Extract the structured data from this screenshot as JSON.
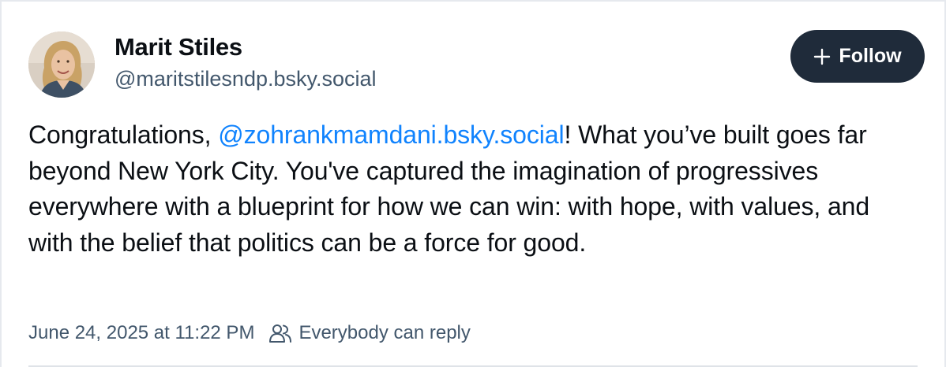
{
  "author": {
    "display_name": "Marit Stiles",
    "handle": "@maritstilesndp.bsky.social",
    "avatar_icon": "user-avatar-photo"
  },
  "follow_button": {
    "label": "Follow",
    "icon": "plus-icon",
    "background": "#1f2b3a",
    "text_color": "#ffffff"
  },
  "post": {
    "text_before_mention": "Congratulations, ",
    "mention": "@zohrankmamdani.bsky.social",
    "text_after_mention": "! What you’ve built goes far beyond New York City. You've captured the imagination of progressives everywhere with a blueprint for how we can win: with hope, with values, and with the belief that politics can be a force for good.",
    "mention_color": "#1083fe"
  },
  "meta": {
    "timestamp": "June 24, 2025 at 11:22 PM",
    "reply_setting": "Everybody can reply",
    "reply_icon": "people-icon"
  }
}
